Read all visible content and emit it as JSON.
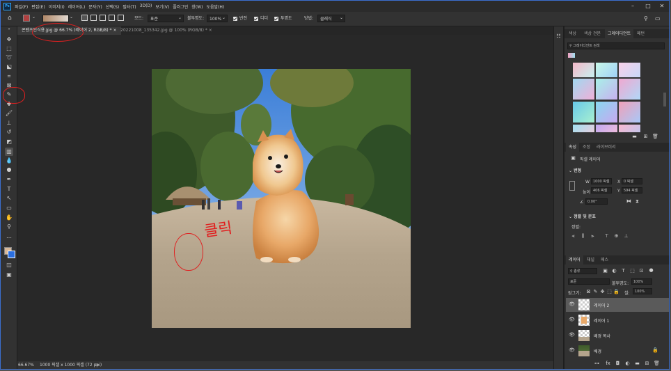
{
  "app": {
    "logo": "Ps"
  },
  "menu": [
    "파일(F)",
    "편집(E)",
    "이미지(I)",
    "레이어(L)",
    "문자(Y)",
    "선택(S)",
    "필터(T)",
    "3D(D)",
    "보기(V)",
    "플러그인",
    "창(W)",
    "도움말(H)"
  ],
  "options": {
    "mode_label": "모드:",
    "mode_value": "표준",
    "opacity_label": "불투명도:",
    "opacity_value": "100%",
    "reverse_label": "반전",
    "dither_label": "디더",
    "transparency_label": "투명도",
    "method_label": "방법:",
    "method_value": "클래식"
  },
  "tabs": [
    {
      "label": "콘텐츠인식용.jpg @ 66.7% (레이어 2, RGB/8) *  ×"
    },
    {
      "label": "20221008_135342.jpg @ 100% (RGB/8) *  ×"
    }
  ],
  "status": {
    "zoom": "66.67%",
    "doc_info": "1000 픽셀 x 1000 픽셀 (72 ppi)",
    "arrow": ">"
  },
  "panel_top": {
    "tabs": [
      "색상",
      "색상 견본",
      "그레이디언트",
      "패턴"
    ],
    "search_placeholder": "그레이디언트 검색"
  },
  "properties": {
    "tabs": [
      "속성",
      "조정",
      "라이브러리"
    ],
    "layer_type": "픽셀 레이어",
    "transform_title": "변형",
    "w_label": "W",
    "w_value": "1000 픽셀",
    "x_label": "X",
    "x_value": "0 픽셀",
    "h_label": "높이",
    "h_value": "406 픽셀",
    "y_label": "Y",
    "y_value": "594 픽셀",
    "angle_value": "0.00°",
    "align_title": "정렬 및 분포",
    "align_label": "정렬:"
  },
  "layers_panel": {
    "tabs": [
      "레이어",
      "채널",
      "패스"
    ],
    "filter_value": "종류",
    "blend_value": "표준",
    "opacity_label": "불투명도:",
    "opacity_value": "100%",
    "lock_label": "잠그기:",
    "fill_label": "칠:",
    "fill_value": "100%",
    "layers": [
      {
        "name": "레이어 2",
        "selected": true
      },
      {
        "name": "레이어 1",
        "selected": false
      },
      {
        "name": "배경 복사",
        "selected": false
      },
      {
        "name": "배경",
        "selected": false
      }
    ]
  },
  "annotation": {
    "text": "클릭"
  },
  "colors": {
    "accent": "#31a8ff",
    "annotation": "#e02020",
    "foreground": "#2b6fe0",
    "background": "#d8b898"
  }
}
